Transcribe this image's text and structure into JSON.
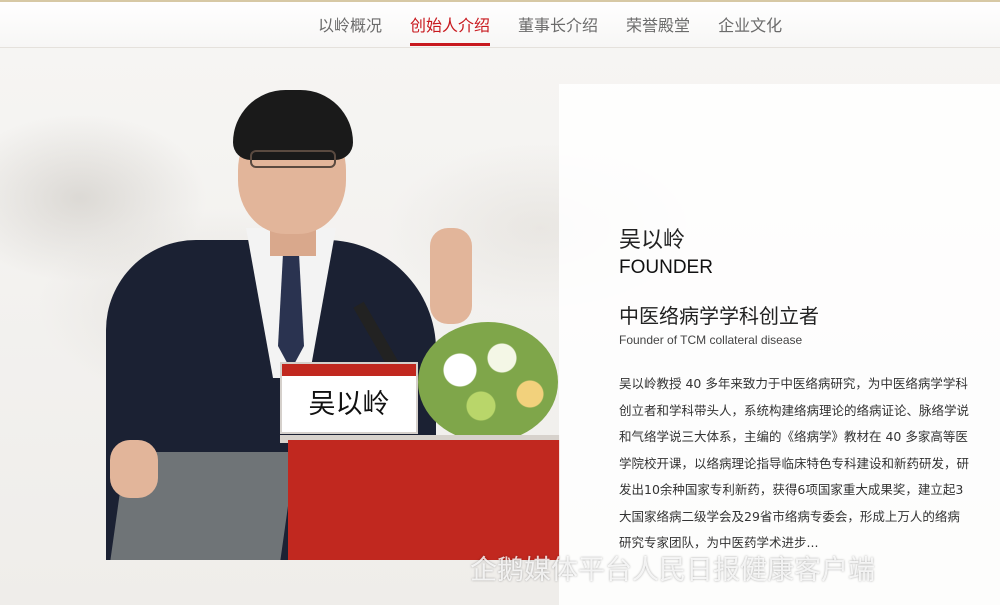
{
  "nav": {
    "items": [
      {
        "label": "以岭概况"
      },
      {
        "label": "创始人介绍"
      },
      {
        "label": "董事长介绍"
      },
      {
        "label": "荣誉殿堂"
      },
      {
        "label": "企业文化"
      }
    ],
    "active_index": 1
  },
  "photo": {
    "nameplate_text": "吴以岭"
  },
  "profile": {
    "name_cn": "吴以岭",
    "name_en": "FOUNDER",
    "role_cn": "中医络病学学科创立者",
    "role_en": "Founder of TCM collateral disease",
    "bio": "吴以岭教授 40 多年来致力于中医络病研究，为中医络病学学科创立者和学科带头人，系统构建络病理论的络病证论、脉络学说和气络学说三大体系，主编的《络病学》教材在 40 多家高等医学院校开课，以络病理论指导临床特色专科建设和新药研发，研发出10余种国家专利新药，获得6项国家重大成果奖，建立起3大国家络病二级学会及29省市络病专委会，形成上万人的络病研究专家团队，为中医药学术进步..."
  },
  "watermark": {
    "text": "企鹅媒体平台人民日报健康客户端"
  },
  "colors": {
    "accent": "#c8181e",
    "nav_text": "#6b6b6b"
  }
}
